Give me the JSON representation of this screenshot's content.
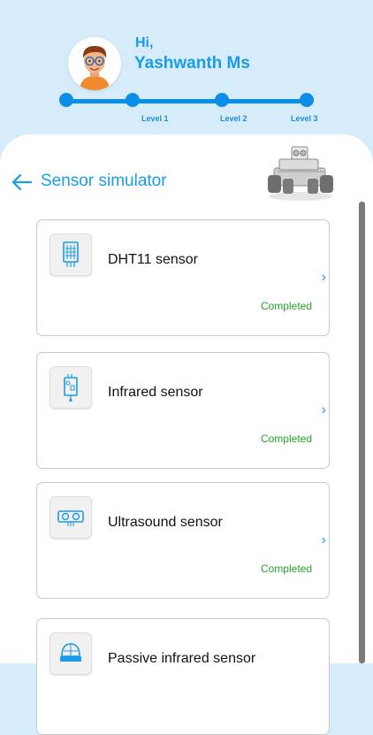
{
  "user": {
    "greeting": "Hi,",
    "name": "Yashwanth Ms"
  },
  "progress": {
    "levels": [
      "Level 1",
      "Level 2",
      "Level 3"
    ]
  },
  "page": {
    "title": "Sensor simulator"
  },
  "sensors": [
    {
      "name": "DHT11 sensor",
      "status": "Completed",
      "icon": "dht11-sensor-icon"
    },
    {
      "name": "Infrared sensor",
      "status": "Completed",
      "icon": "infrared-sensor-icon"
    },
    {
      "name": "Ultrasound sensor",
      "status": "Completed",
      "icon": "ultrasound-sensor-icon"
    },
    {
      "name": "Passive infrared sensor",
      "status": "",
      "icon": "pir-sensor-icon"
    }
  ],
  "colors": {
    "accent": "#1a9be8",
    "header_bg": "#d6ecfa",
    "status_completed": "#25a12d"
  }
}
